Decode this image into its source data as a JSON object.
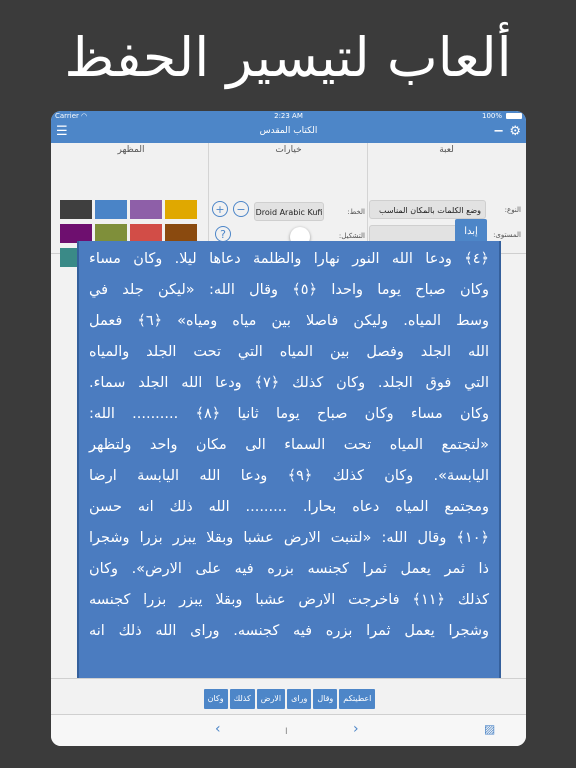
{
  "promo": {
    "headline": "ألعاب لتيسير الحفظ"
  },
  "status_bar": {
    "carrier": "Carrier",
    "time": "2:23 AM",
    "battery": "100%"
  },
  "nav": {
    "title": "الكتاب المقدس",
    "menu_icon": "menu-icon",
    "minus_icon": "minus-icon",
    "settings_icon": "gear-icon"
  },
  "settings_panel": {
    "game": {
      "title": "لعبة",
      "type_label": "النوع:",
      "type_value": "وضع الكلمات بالمكان المناسب",
      "level_label": "المستوى:",
      "level_value": "سهل",
      "start_label": "إبدا"
    },
    "options": {
      "title": "خيارات",
      "font_label": "الخط:",
      "font_value": "Droid Arabic Kufi",
      "tashkeel_label": "التشكيل:",
      "plus": "+",
      "minus": "−",
      "help": "?"
    },
    "appearance": {
      "title": "المظهر",
      "swatches": [
        "#e0a800",
        "#8e5fa8",
        "#4a84c7",
        "#3f3f3f",
        "#8a4a0f",
        "#d24d47",
        "#7f8f3a",
        "#6e0f6f",
        "#2f3d54",
        "#66a83e",
        "#ef8a1e",
        "#3a8a87"
      ]
    }
  },
  "passage": {
    "lines": [
      "﴿٤﴾ ودعا الله النور نهارا والظلمة دعاها ليلا. وكان مساء",
      "وكان صباح يوما واحدا ﴿٥﴾ وقال الله: «ليكن جلد في",
      "وسط المياه. وليكن فاصلا بين مياه ومياه» ﴿٦﴾ فعمل",
      "الله الجلد وفصل بين المياه التي تحت الجلد والمياه",
      "التي فوق الجلد. وكان كذلك ﴿٧﴾ ودعا الله الجلد سماء.",
      "وكان مساء وكان صباح يوما ثانيا ﴿٨﴾ .......... الله:",
      "«لتجتمع المياه تحت السماء الى مكان واحد ولتظهر",
      "اليابسة». وكان كذلك ﴿٩﴾ ودعا الله اليابسة ارضا",
      "ومجتمع المياه دعاه بحارا. ......... الله ذلك انه حسن",
      "﴿١٠﴾ وقال الله: «لتنبت الارض عشبا وبقلا يبزر بزرا وشجرا",
      "ذا ثمر يعمل ثمرا كجنسه بزره فيه على الارض». وكان",
      "كذلك ﴿١١﴾ فاخرجت الارض عشبا وبقلا يبزر بزرا كجنسه",
      "وشجرا يعمل ثمرا بزره فيه كجنسه. ورای الله ذلك انه"
    ]
  },
  "word_choices": [
    "اعطيتكم",
    "وقال",
    "ورای",
    "الارض",
    "كذلك",
    "وكان"
  ],
  "bottom_bar": {
    "prev_icon": "chevron-left-icon",
    "page_indicator": "I",
    "next_icon": "chevron-right-icon",
    "image_icon": "image-icon"
  }
}
